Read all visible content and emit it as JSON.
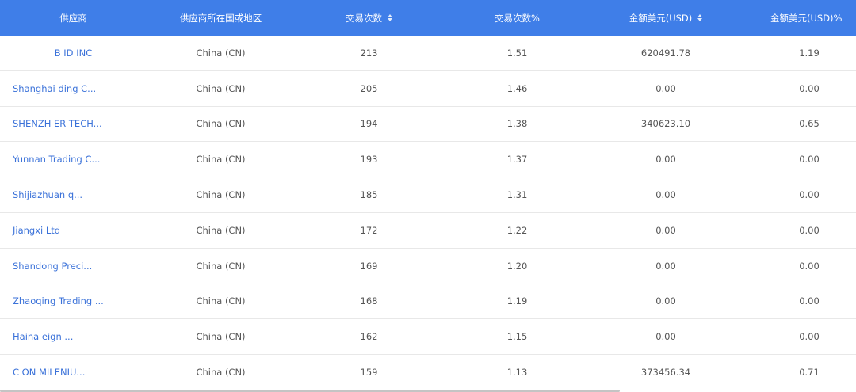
{
  "table": {
    "headers": {
      "supplier": "供应商",
      "region": "供应商所在国或地区",
      "trade_count": "交易次数",
      "trade_count_pct": "交易次数%",
      "amount_usd": "金额美元(USD)",
      "amount_usd_pct": "金额美元(USD)%"
    },
    "rows": [
      {
        "supplier": "B            ID INC",
        "region": "China (CN)",
        "trade_count": "213",
        "trade_count_pct": "1.51",
        "amount_usd": "620491.78",
        "amount_usd_pct": "1.19"
      },
      {
        "supplier": "Shanghai              ding C...",
        "region": "China (CN)",
        "trade_count": "205",
        "trade_count_pct": "1.46",
        "amount_usd": "0.00",
        "amount_usd_pct": "0.00"
      },
      {
        "supplier": "SHENZH            ER TECH...",
        "region": "China (CN)",
        "trade_count": "194",
        "trade_count_pct": "1.38",
        "amount_usd": "340623.10",
        "amount_usd_pct": "0.65"
      },
      {
        "supplier": "Yunnan           Trading C...",
        "region": "China (CN)",
        "trade_count": "193",
        "trade_count_pct": "1.37",
        "amount_usd": "0.00",
        "amount_usd_pct": "0.00"
      },
      {
        "supplier": "Shijiazhuan               q...",
        "region": "China (CN)",
        "trade_count": "185",
        "trade_count_pct": "1.31",
        "amount_usd": "0.00",
        "amount_usd_pct": "0.00"
      },
      {
        "supplier": "Jiangxi              Ltd",
        "region": "China (CN)",
        "trade_count": "172",
        "trade_count_pct": "1.22",
        "amount_usd": "0.00",
        "amount_usd_pct": "0.00"
      },
      {
        "supplier": "Shandong            Preci...",
        "region": "China (CN)",
        "trade_count": "169",
        "trade_count_pct": "1.20",
        "amount_usd": "0.00",
        "amount_usd_pct": "0.00"
      },
      {
        "supplier": "Zhaoqing          Trading ...",
        "region": "China (CN)",
        "trade_count": "168",
        "trade_count_pct": "1.19",
        "amount_usd": "0.00",
        "amount_usd_pct": "0.00"
      },
      {
        "supplier": "Haina             eign ...",
        "region": "China (CN)",
        "trade_count": "162",
        "trade_count_pct": "1.15",
        "amount_usd": "0.00",
        "amount_usd_pct": "0.00"
      },
      {
        "supplier": "C           ON MILENIU...",
        "region": "China (CN)",
        "trade_count": "159",
        "trade_count_pct": "1.13",
        "amount_usd": "373456.34",
        "amount_usd_pct": "0.71"
      }
    ]
  },
  "colors": {
    "header_bg": "#3f7ee8",
    "link": "#3b72d9",
    "text": "#555555",
    "divider": "#e8e8e8"
  },
  "icons": {
    "sort": "sort-icon"
  }
}
